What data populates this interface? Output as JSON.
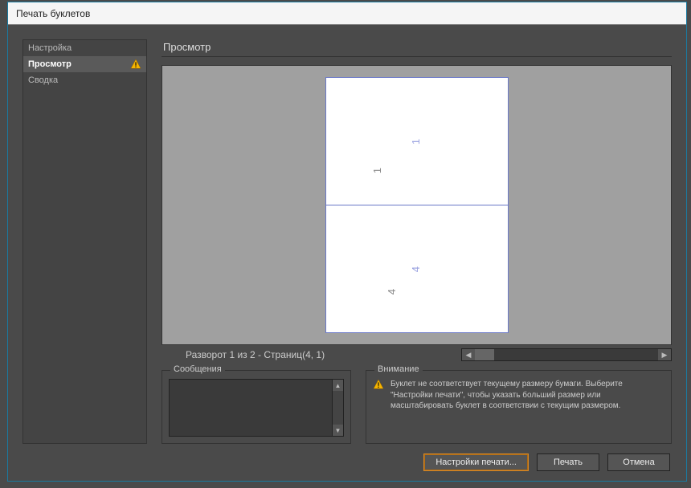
{
  "dialog": {
    "title": "Печать буклетов"
  },
  "sidebar": {
    "items": [
      {
        "label": "Настройка",
        "warning": false
      },
      {
        "label": "Просмотр",
        "warning": true
      },
      {
        "label": "Сводка",
        "warning": false
      }
    ],
    "selectedIndex": 1
  },
  "preview": {
    "heading": "Просмотр",
    "status": "Разворот 1 из 2 - Страниц(4, 1)",
    "pages": [
      {
        "primary": "1",
        "secondary": "1"
      },
      {
        "primary": "4",
        "secondary": "4"
      }
    ]
  },
  "messages": {
    "legend": "Сообщения",
    "text": ""
  },
  "attention": {
    "legend": "Внимание",
    "text": "Буклет не соответствует текущему размеру бумаги. Выберите \"Настройки печати\", чтобы указать больший размер или масштабировать буклет в соответствии с текущим размером."
  },
  "buttons": {
    "printSettings": "Настройки печати...",
    "print": "Печать",
    "cancel": "Отмена"
  }
}
